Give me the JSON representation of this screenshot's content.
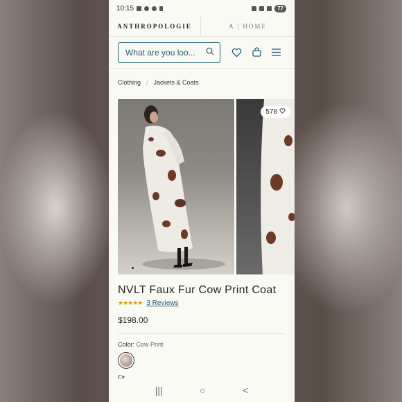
{
  "status_bar": {
    "time": "10:15",
    "battery": "77"
  },
  "brand": {
    "main": "ANTHROPOLOGIE",
    "home": "A | HOME"
  },
  "search": {
    "placeholder": "What are you loo..."
  },
  "icons": {
    "search": "search-icon",
    "wishlist": "heart-icon",
    "bag": "shopping-bag-icon",
    "menu": "hamburger-menu-icon"
  },
  "breadcrumb": {
    "items": [
      "Clothing",
      "Jackets & Coats"
    ],
    "separator": "/"
  },
  "gallery": {
    "like_count": "578",
    "image_count": 4,
    "active_index": 0
  },
  "product": {
    "title": "NVLT Faux Fur Cow Print Coat",
    "rating_stars": "★★★★★",
    "rating": 4.5,
    "reviews_label": "3 Reviews",
    "price": "$198.00",
    "color_label": "Color:",
    "color_value": "Cow Print",
    "fit_label_peek": "Fit"
  },
  "nav_bar": {
    "recent": "|||",
    "home": "○",
    "back": "<"
  },
  "colors": {
    "accent": "#1f5f70",
    "star": "#d4a019",
    "page_bg": "#fafaf5"
  }
}
